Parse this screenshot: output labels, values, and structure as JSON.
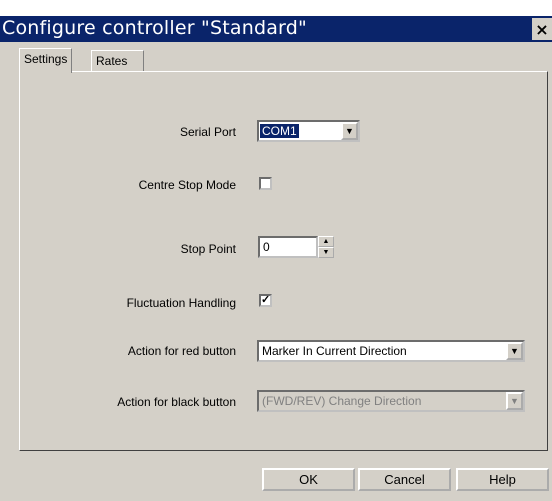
{
  "window": {
    "title": "Configure controller \"Standard\"",
    "close_glyph": "×"
  },
  "tabs": [
    {
      "label": "Settings"
    },
    {
      "label": "Rates"
    }
  ],
  "fields": {
    "serial_port": {
      "label": "Serial Port",
      "value": "COM1"
    },
    "centre_stop_mode": {
      "label": "Centre Stop Mode",
      "checked": false
    },
    "stop_point": {
      "label": "Stop Point",
      "value": "0"
    },
    "fluctuation_handling": {
      "label": "Fluctuation Handling",
      "checked": true,
      "mark": "✓"
    },
    "red_button": {
      "label": "Action for red button",
      "value": "Marker In Current Direction"
    },
    "black_button": {
      "label": "Action for black button",
      "value": "(FWD/REV) Change Direction",
      "disabled": true
    }
  },
  "buttons": {
    "ok": "OK",
    "cancel": "Cancel",
    "help": "Help"
  },
  "colors": {
    "titlebar": "#0a246a",
    "face": "#d4d0c8",
    "selection": "#0a246a"
  },
  "icons": {
    "dropdown": "dropdown-arrow-icon",
    "spin_up": "spin-up-icon",
    "spin_down": "spin-down-icon",
    "close": "close-icon"
  }
}
